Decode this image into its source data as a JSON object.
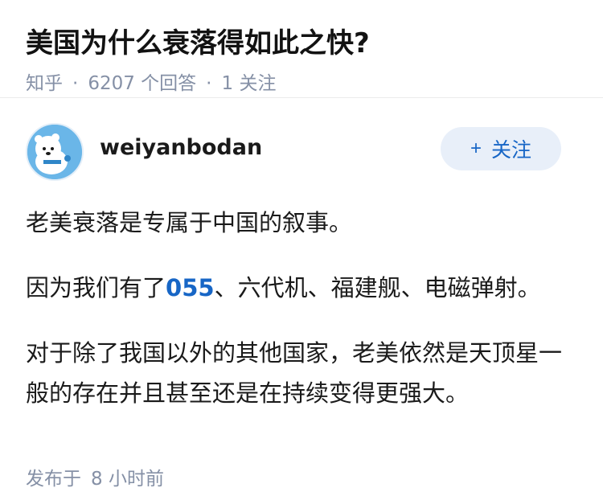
{
  "question": {
    "title": "美国为什么衰落得如此之快?",
    "source": "知乎",
    "answer_count": "6207",
    "answer_count_unit": "个回答",
    "follow_count": "1",
    "follow_label": "关注"
  },
  "answer": {
    "author": {
      "name": "weiyanbodan",
      "avatar_icon": "white-bear-avatar-icon",
      "follow_button_label": "关注",
      "follow_button_icon": "+"
    },
    "paragraphs": [
      {
        "text": "老美衰落是专属于中国的叙事。"
      },
      {
        "before": "因为我们有了",
        "link": "055",
        "after": "、六代机、福建舰、电磁弹射。"
      },
      {
        "text": "对于除了我国以外的其他国家，老美依然是天顶星一般的存在并且甚至还是在持续变得更强大。"
      }
    ],
    "post_time_label": "发布于",
    "post_time_value": "8 小时前"
  },
  "colors": {
    "accent": "#1766c6",
    "meta": "#8590a6",
    "follow_bg": "#e8eff9"
  }
}
